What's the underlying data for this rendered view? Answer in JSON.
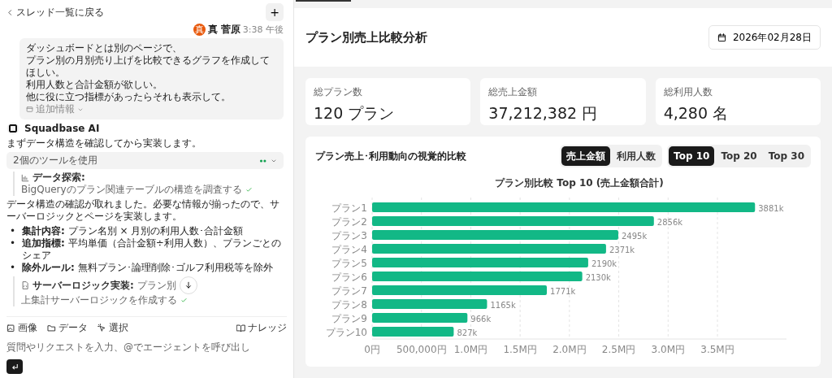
{
  "sidebar": {
    "back_link": "スレッド一覧に戻る",
    "new_button": "+",
    "user_message": {
      "avatar": "真",
      "name": "真 菅原",
      "time": "3:38 午後",
      "lines": [
        "ダッシュボードとは別のページで、",
        "プラン別の月別売り上げを比較できるグラフを作成してほしい。",
        "利用人数と合計金額が欲しい。",
        "他に役に立つ指標があったらそれも表示して。"
      ],
      "attachment": "追加情報"
    },
    "assistant": {
      "name": "Squadbase AI",
      "intro": "まずデータ構造を確認してから実装します。",
      "tools_summary": "2個のツールを使用",
      "step_1": {
        "label": "データ探索:",
        "text": "BigQueryのプラン関連テーブルの構造を調査する",
        "done": true
      },
      "body": "データ構造の確認が取れました。必要な情報が揃ったので、サーバーロジックとページを実装します。",
      "bullets": [
        {
          "marker": "•",
          "label": "集計内容:",
          "text": "プラン名別 × 月別の利用人数･合計金額"
        },
        {
          "marker": "•",
          "label": "追加指標:",
          "text": "平均単価（合計金額÷利用人数）、プランごとのシェア"
        },
        {
          "marker": "•",
          "label": "除外ルール:",
          "text": "無料プラン･論理削除･ゴルフ利用税等を除外"
        }
      ],
      "step_2": {
        "label": "サーバーロジック実装:",
        "text_parts": [
          "プラン別",
          "上集計サーバーロジックを作成する"
        ],
        "done": true
      }
    },
    "composer": {
      "tools": [
        {
          "kind": "image",
          "label": "画像"
        },
        {
          "kind": "folder",
          "label": "データ"
        },
        {
          "kind": "select",
          "label": "選択"
        }
      ],
      "knowledge": "ナレッジ",
      "placeholder": "質問やリクエストを入力、@でエージェントを呼び出し"
    }
  },
  "main": {
    "title": "プラン別売上比較分析",
    "date": "2026年02月28日",
    "stats": [
      {
        "label": "総プラン数",
        "value": "120 プラン"
      },
      {
        "label": "総売上金額",
        "value": "37,212,382 円"
      },
      {
        "label": "総利用人数",
        "value": "4,280 名"
      }
    ],
    "chart_panel": {
      "title": "プラン売上･利用動向の視覚的比較",
      "metric_toggle": [
        {
          "label": "売上金額",
          "selected": true
        },
        {
          "label": "利用人数",
          "selected": false
        }
      ],
      "range_toggle": [
        {
          "label": "Top 10",
          "selected": true
        },
        {
          "label": "Top 20",
          "selected": false
        },
        {
          "label": "Top 30",
          "selected": false
        }
      ],
      "chart_data": {
        "type": "bar",
        "orientation": "horizontal",
        "title": "プラン別比較 Top 10 (売上金額合計)",
        "grid": true,
        "xlim": [
          0,
          4200000
        ],
        "categories": [
          "プラン1",
          "プラン2",
          "プラン3",
          "プラン4",
          "プラン5",
          "プラン6",
          "プラン7",
          "プラン8",
          "プラン9",
          "プラン10"
        ],
        "series": [
          {
            "color": "#12b886",
            "values": [
              3881000,
              2856000,
              2495000,
              2371000,
              2190000,
              2130000,
              1771000,
              1165000,
              966000,
              827000
            ]
          }
        ],
        "value_labels": [
          "3881k",
          "2856k",
          "2495k",
          "2371k",
          "2190k",
          "2130k",
          "1771k",
          "1165k",
          "966k",
          "827k"
        ],
        "xticks": [
          {
            "value": 0,
            "label": "0円"
          },
          {
            "value": 500000,
            "label": "500,000円"
          },
          {
            "value": 1000000,
            "label": "1.0M円"
          },
          {
            "value": 1500000,
            "label": "1.5M円"
          },
          {
            "value": 2000000,
            "label": "2.0M円"
          },
          {
            "value": 2500000,
            "label": "2.5M円"
          },
          {
            "value": 3000000,
            "label": "3.0M円"
          },
          {
            "value": 3500000,
            "label": "3.5M円"
          }
        ]
      }
    }
  }
}
